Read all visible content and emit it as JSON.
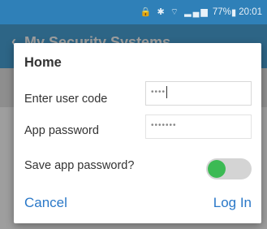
{
  "status_bar": {
    "icons": "🔒 ✱ ⌔ ▂▄▆",
    "battery": "77%",
    "battery_icon": "▮",
    "time": "20:01"
  },
  "app_bar": {
    "back_icon": "‹",
    "title": "My Security Systems"
  },
  "dialog": {
    "title": "Home",
    "user_code": {
      "label": "Enter user code",
      "value": "••••"
    },
    "app_password": {
      "label": "App password",
      "value": "•••••••"
    },
    "save_password": {
      "label": "Save app password?",
      "enabled": true
    },
    "cancel_label": "Cancel",
    "login_label": "Log In"
  },
  "colors": {
    "status_bar": "#2f80b8",
    "app_bar": "#4aa3d8",
    "accent": "#2a78c8",
    "toggle_on": "#3cba54"
  }
}
